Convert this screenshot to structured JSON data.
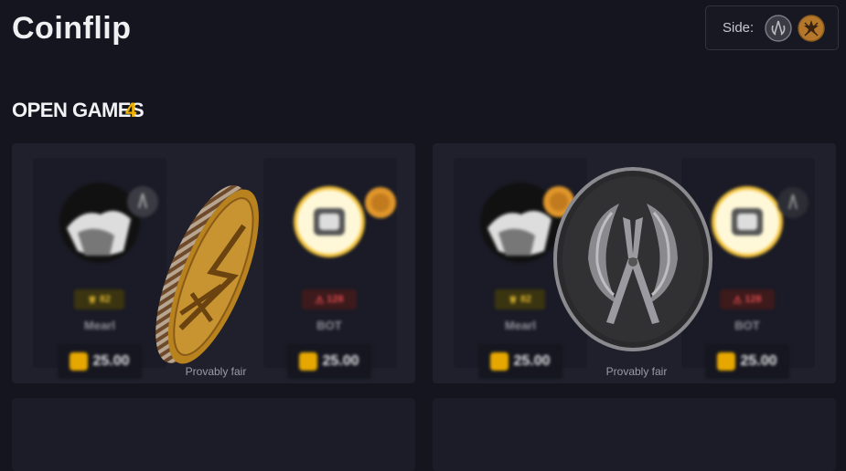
{
  "page": {
    "title": "Coinflip"
  },
  "side_selector": {
    "label": "Side:",
    "options": [
      "ct-icon",
      "t-icon"
    ]
  },
  "open_games": {
    "label": "OPEN GAMES",
    "count": "4"
  },
  "games": [
    {
      "players": [
        {
          "name": "Mearl",
          "level": "82",
          "amount": "25.00",
          "side": "ct"
        },
        {
          "name": "BOT",
          "level": "128",
          "amount": "25.00",
          "side": "t"
        }
      ],
      "coin_face": "t-coin-edge",
      "fair_label": "Provably fair"
    },
    {
      "players": [
        {
          "name": "Mearl",
          "level": "82",
          "amount": "25.00",
          "side": "t"
        },
        {
          "name": "BOT",
          "level": "128",
          "amount": "25.00",
          "side": "ct"
        }
      ],
      "coin_face": "ct-coin-face",
      "fair_label": "Provably fair"
    }
  ],
  "colors": {
    "accent": "#f0b400",
    "bg": "#14151f",
    "card": "#1f202c"
  }
}
